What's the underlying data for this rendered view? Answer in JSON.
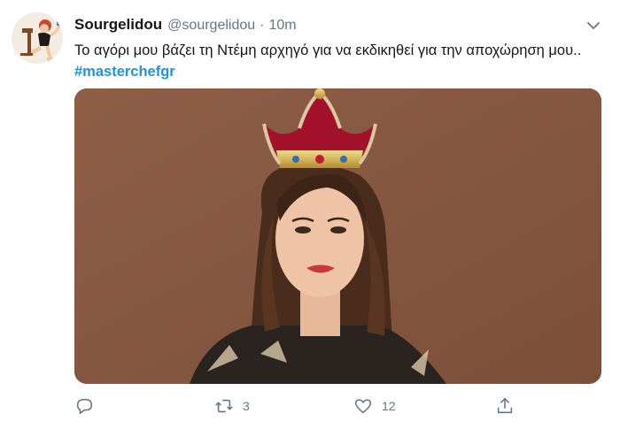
{
  "tweet": {
    "display_name": "Sourgelidou",
    "handle": "@sourgelidou",
    "separator": "·",
    "time": "10m",
    "text": "Το αγόρι μου βάζει τη Ντέμη αρχηγό για να εκδικηθεί για την αποχώρηση μου..",
    "hashtag": "#masterchefgr",
    "icons": {
      "menu": "chevron-down-icon",
      "reply": "reply-icon",
      "retweet": "retweet-icon",
      "like": "heart-icon",
      "share": "share-icon"
    }
  },
  "actions": {
    "retweet_count": "3",
    "like_count": "12"
  },
  "colors": {
    "text": "#14171a",
    "secondary": "#657786",
    "link": "#1b95e0",
    "media_background": "#8a5b45"
  }
}
